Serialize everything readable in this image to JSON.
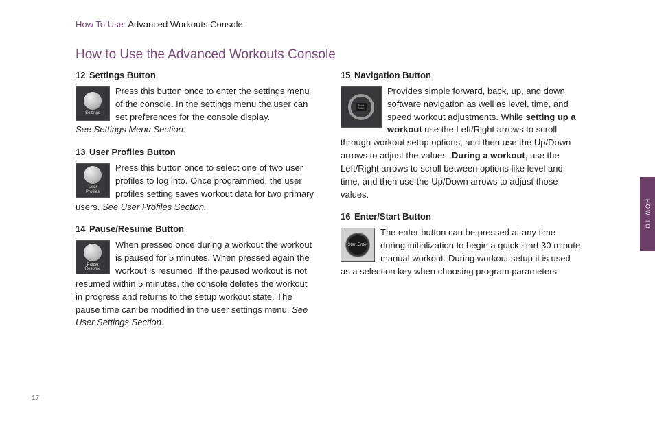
{
  "header": {
    "prefix": "How To Use: ",
    "suffix": "Advanced Workouts Console"
  },
  "title": "How to Use the Advanced Workouts Console",
  "sideTab": "HOW TO",
  "pageNumber": "17",
  "left": {
    "i12": {
      "num": "12",
      "title": "Settings Button",
      "iconLabel": "Settings",
      "body": "Press this button once to enter the settings menu of the console. In the settings menu the user can set preferences for the console display. ",
      "note": "See Settings Menu Section."
    },
    "i13": {
      "num": "13",
      "title": "User Profiles Button",
      "iconLabel1": "User",
      "iconLabel2": "Profiles",
      "body": "Press this button once to select one of two user profiles to log into. Once programmed, the user profiles setting saves workout data for two primary users. ",
      "note": "See User Profiles Section."
    },
    "i14": {
      "num": "14",
      "title": "Pause/Resume Button",
      "iconLabel1": "Pause",
      "iconLabel2": "Resume",
      "body": "When pressed once during a workout the workout is paused for 5 minutes. When pressed again the workout is resumed. If the paused workout is not resumed within 5 minutes, the console deletes the workout in progress and returns to the setup workout state. The pause time can be modified in the user settings menu. ",
      "note": "See User Settings Section."
    }
  },
  "right": {
    "i15": {
      "num": "15",
      "title": "Navigation Button",
      "centerLabel": "Start Enter",
      "p1": "Provides simple forward, back, up, and down software navigation as well as level, time, and speed workout adjustments. While ",
      "b1": "setting up a workout",
      "p2": " use the Left/Right arrows to scroll through workout setup options, and then use the Up/Down arrows to adjust the values. ",
      "b2": "During a workout",
      "p3": ", use the Left/Right arrows to scroll between options like level and time, and then use the Up/Down arrows to adjust those values."
    },
    "i16": {
      "num": "16",
      "title": "Enter/Start Button",
      "iconLabel": "Start Enter",
      "body": "The enter button can be pressed at any time during initialization to begin a quick start 30 minute manual workout. During workout setup it is used as a selection key when choosing program parameters."
    }
  }
}
